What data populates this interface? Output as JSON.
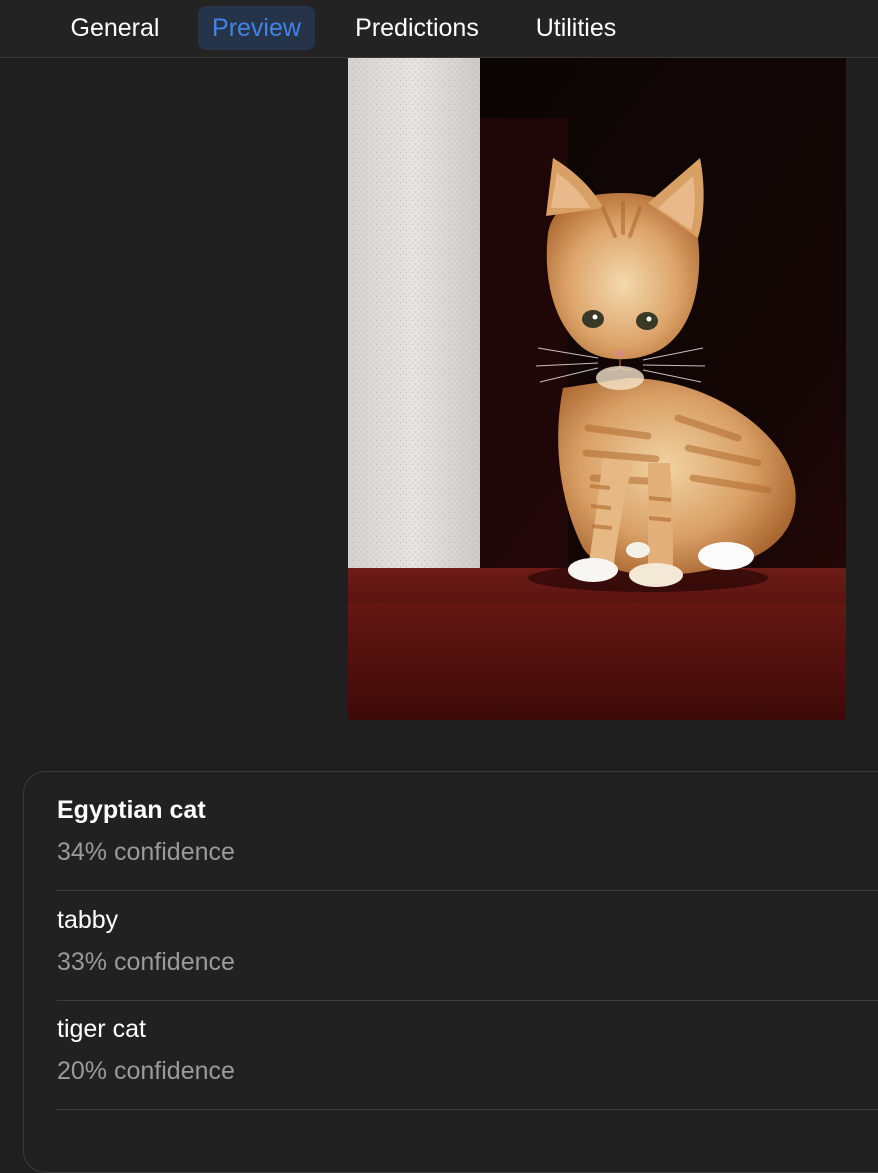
{
  "tabs": [
    {
      "label": "General",
      "active": false
    },
    {
      "label": "Preview",
      "active": true
    },
    {
      "label": "Predictions",
      "active": false
    },
    {
      "label": "Utilities",
      "active": false
    }
  ],
  "colors": {
    "accent": "#3f84e6",
    "active_tab_bg": "#26344a",
    "background": "#1f1f1f",
    "secondary_text": "#9a9a9a"
  },
  "preview": {
    "image_subject": "orange tabby kitten sitting in a doorway"
  },
  "predictions": [
    {
      "label": "Egyptian cat",
      "confidence": "34% confidence"
    },
    {
      "label": "tabby",
      "confidence": "33% confidence"
    },
    {
      "label": "tiger cat",
      "confidence": "20% confidence"
    }
  ]
}
